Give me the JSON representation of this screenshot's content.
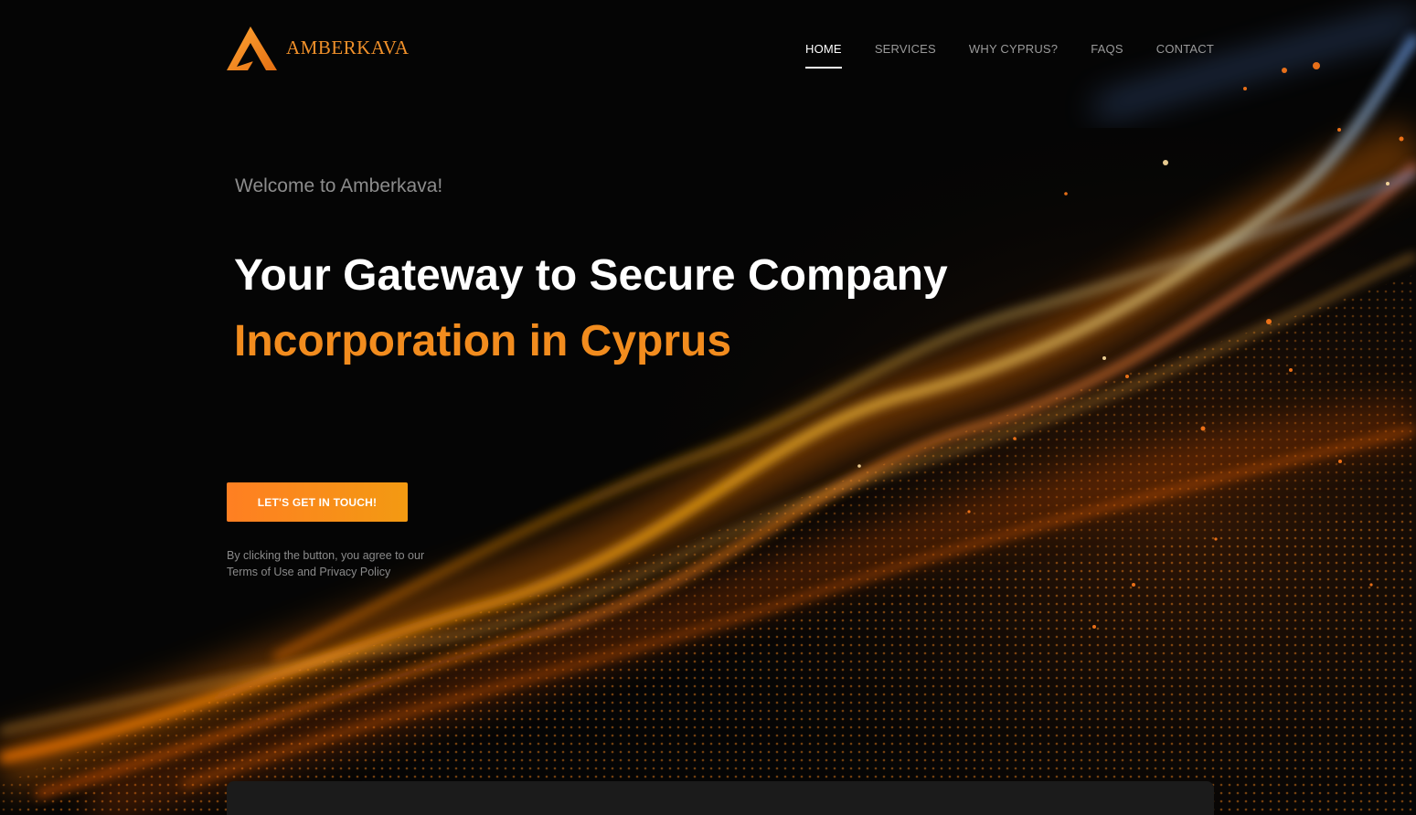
{
  "brand": {
    "name": "AMBERKAVA",
    "logo_icon": "amber-a-logo-icon",
    "accent_color": "#f28c1e"
  },
  "nav": {
    "items": [
      {
        "label": "HOME",
        "active": true
      },
      {
        "label": "SERVICES",
        "active": false
      },
      {
        "label": "WHY CYPRUS?",
        "active": false
      },
      {
        "label": "FAQS",
        "active": false
      },
      {
        "label": "CONTACT",
        "active": false
      }
    ]
  },
  "hero": {
    "welcome": "Welcome to Amberkava!",
    "headline_line1": "Your Gateway to Secure Company",
    "headline_line2": "Incorporation in Cyprus",
    "cta_label": "LET'S GET IN TOUCH!",
    "disclaimer": "By clicking the button, you agree to our Terms of Use and Privacy Policy",
    "background": "glowing-particle-wave"
  },
  "colors": {
    "background": "#050505",
    "button_start": "#ff7f22",
    "button_end": "#f39a12",
    "panel": "#1b1b1b"
  }
}
